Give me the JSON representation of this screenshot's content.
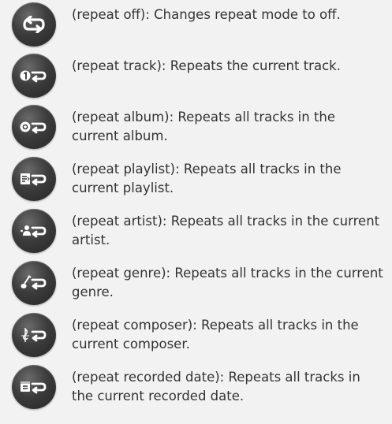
{
  "items": [
    {
      "icon": "repeat-off-icon",
      "text": "(repeat off): Changes repeat mode to off."
    },
    {
      "icon": "repeat-track-icon",
      "text": "(repeat track): Repeats the current track."
    },
    {
      "icon": "repeat-album-icon",
      "text": "(repeat album): Repeats all tracks in the current album."
    },
    {
      "icon": "repeat-playlist-icon",
      "text": "(repeat playlist): Repeats all tracks in the current playlist."
    },
    {
      "icon": "repeat-artist-icon",
      "text": "(repeat artist): Repeats all tracks in the current artist."
    },
    {
      "icon": "repeat-genre-icon",
      "text": "(repeat genre): Repeats all tracks in the current genre."
    },
    {
      "icon": "repeat-composer-icon",
      "text": "(repeat composer): Repeats all tracks in the current composer."
    },
    {
      "icon": "repeat-recorded-date-icon",
      "text": "(repeat recorded date): Repeats all tracks in the current recorded date."
    }
  ],
  "colors": {
    "background": "#f2f2f2",
    "button": "#3a3a3a",
    "glyph": "#ffffff",
    "text": "#333333"
  }
}
